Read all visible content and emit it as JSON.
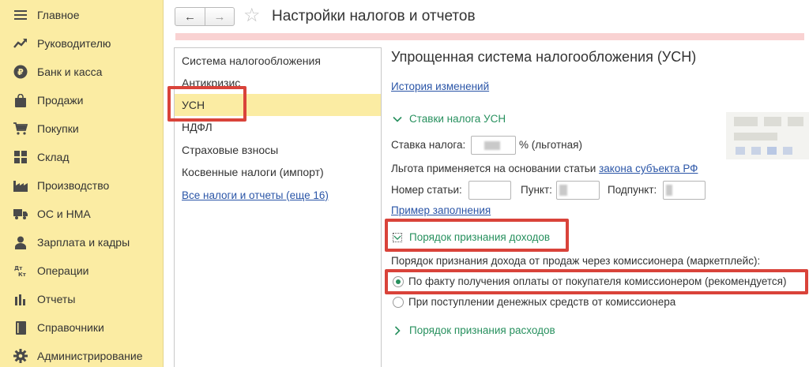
{
  "sidebar": {
    "items": [
      {
        "label": "Главное",
        "icon": "menu-icon"
      },
      {
        "label": "Руководителю",
        "icon": "trend-icon"
      },
      {
        "label": "Банк и касса",
        "icon": "ruble-icon"
      },
      {
        "label": "Продажи",
        "icon": "bag-icon"
      },
      {
        "label": "Покупки",
        "icon": "cart-icon"
      },
      {
        "label": "Склад",
        "icon": "warehouse-icon"
      },
      {
        "label": "Производство",
        "icon": "factory-icon"
      },
      {
        "label": "ОС и НМА",
        "icon": "truck-icon"
      },
      {
        "label": "Зарплата и кадры",
        "icon": "person-icon"
      },
      {
        "label": "Операции",
        "icon": "debit-credit-icon",
        "glyph": "Дт Кт"
      },
      {
        "label": "Отчеты",
        "icon": "bar-chart-icon"
      },
      {
        "label": "Справочники",
        "icon": "book-icon"
      },
      {
        "label": "Администрирование",
        "icon": "gear-icon"
      }
    ]
  },
  "header": {
    "title": "Настройки налогов и отчетов",
    "back": "←",
    "forward": "→",
    "star": "☆"
  },
  "left_panel": {
    "items": [
      {
        "label": "Система налогообложения"
      },
      {
        "label": "Антикризис"
      },
      {
        "label": "УСН",
        "selected": true
      },
      {
        "label": "НДФЛ"
      },
      {
        "label": "Страховые взносы"
      },
      {
        "label": "Косвенные налоги (импорт)"
      },
      {
        "label": "Все налоги и отчеты (еще 16)",
        "link": true
      }
    ]
  },
  "main": {
    "title": "Упрощенная система налогообложения (УСН)",
    "history_link": "История изменений",
    "rates_group": "Ставки налога УСН",
    "rate_label": "Ставка налога:",
    "rate_suffix": "% (льготная)",
    "basis_label": "Льгота применяется на основании статьи",
    "basis_link": "закона субъекта РФ",
    "article_label": "Номер статьи:",
    "point_label": "Пункт:",
    "subpoint_label": "Подпункт:",
    "example_link": "Пример заполнения",
    "income_group": "Порядок признания доходов",
    "income_question": "Порядок признания дохода от продаж через комиссионера (маркетплейс):",
    "option_1": "По факту получения оплаты от покупателя комиссионером (рекомендуется)",
    "option_2": "При поступлении денежных средств от комиссионера",
    "selected_option": 1,
    "expense_group": "Порядок признания расходов"
  },
  "colors": {
    "sidebar_bg": "#fbeca3",
    "accent_green": "#27905e",
    "link_blue": "#2a55a7",
    "highlight_red": "#d9433a",
    "pink_bar": "#f9d2d2"
  }
}
